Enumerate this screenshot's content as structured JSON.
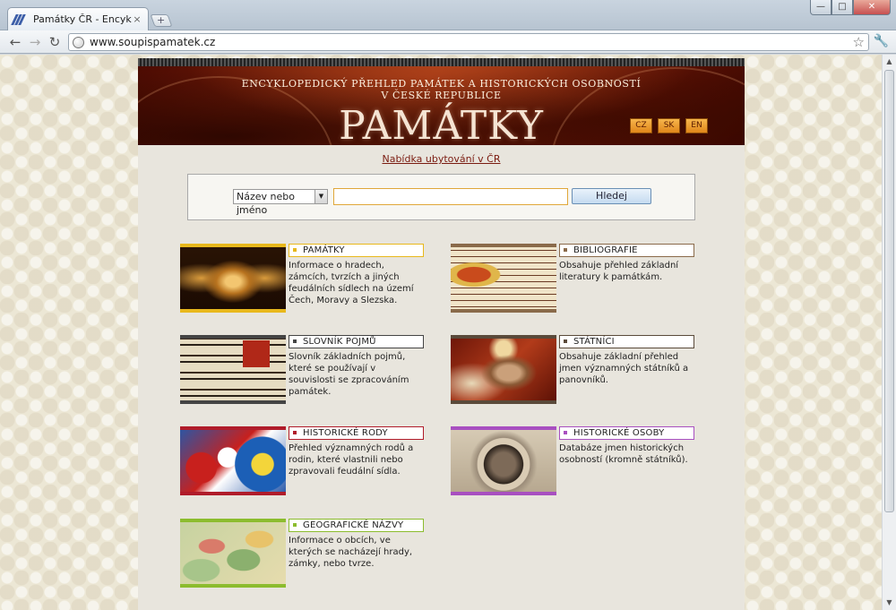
{
  "browser": {
    "tab_title": "Památky ČR - Encyklope...",
    "tab_close": "×",
    "new_tab": "+",
    "url": "www.soupispamatek.cz",
    "nav": {
      "back": "←",
      "forward": "→",
      "reload": "↻",
      "star": "☆",
      "wrench": "🔧"
    },
    "window": {
      "minimize": "—",
      "maximize": "□",
      "close": "✕"
    }
  },
  "header": {
    "line1": "ENCYKLOPEDICKÝ PŘEHLED PAMÁTEK A HISTORICKÝCH OSOBNOSTÍ",
    "line2": "V ČESKÉ REPUBLICE",
    "title": "PAMÁTKY",
    "languages": [
      "CZ",
      "SK",
      "EN"
    ]
  },
  "accommodation_link": "Nabídka ubytování v ČR",
  "search": {
    "select_value": "Název nebo jméno",
    "input_value": "",
    "button_label": "Hledej"
  },
  "categories": [
    {
      "label": "PAMÁTKY",
      "desc": "Informace o hradech, zámcích, tvrzích a jiných feudálních sídlech na území Čech, Moravy a Slezska.",
      "color": "#e8b81c"
    },
    {
      "label": "BIBLIOGRAFIE",
      "desc": "Obsahuje přehled základní literatury k památkám.",
      "color": "#8a6a4a"
    },
    {
      "label": "SLOVNÍK POJMŮ",
      "desc": "Slovník základních pojmů, které se používají v souvislosti se zpracováním památek.",
      "color": "#444444"
    },
    {
      "label": "STÁTNÍCI",
      "desc": "Obsahuje základní přehled jmen významných státníků a panovníků.",
      "color": "#5a4a3a"
    },
    {
      "label": "HISTORICKÉ RODY",
      "desc": "Přehled významných rodů a rodin, které vlastnili nebo zpravovali feudální sídla.",
      "color": "#b01c2a"
    },
    {
      "label": "HISTORICKÉ OSOBY",
      "desc": "Databáze jmen historických osobností (kromně státníků).",
      "color": "#a84fc0"
    },
    {
      "label": "GEOGRAFICKÉ NÁZVY",
      "desc": "Informace o obcích, ve kterých se nacházejí hrady, zámky, nebo tvrze.",
      "color": "#8cbc2e"
    }
  ]
}
